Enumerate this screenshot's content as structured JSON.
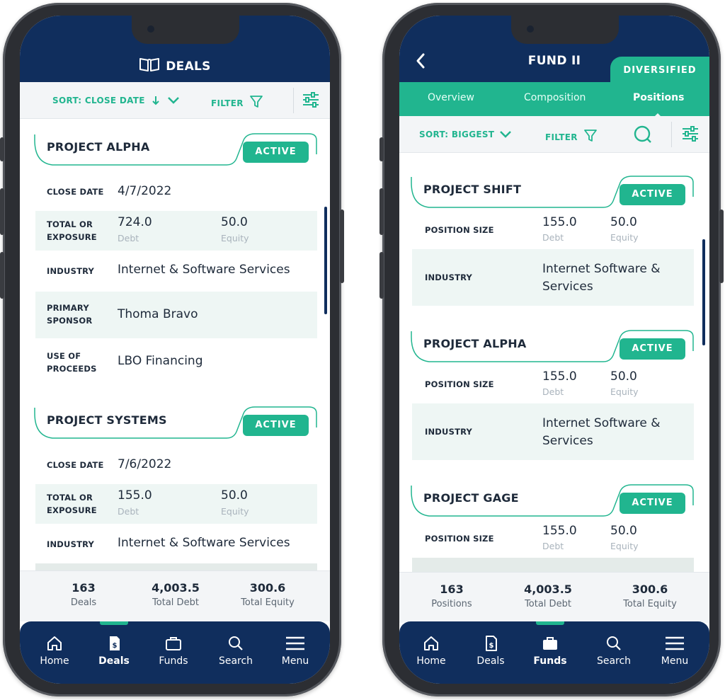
{
  "colors": {
    "navy": "#102e5d",
    "teal": "#21b58f",
    "shade": "#eef6f4"
  },
  "deals_screen": {
    "header": {
      "title": "DEALS",
      "icon": "book-icon"
    },
    "toolbar": {
      "sort_label": "SORT: CLOSE DATE",
      "filter_label": "FILTER"
    },
    "cards": [
      {
        "title": "PROJECT ALPHA",
        "status": "ACTIVE",
        "close_date_label": "CLOSE DATE",
        "close_date": "4/7/2022",
        "exposure_label": "TOTAL OR EXPOSURE",
        "debt": "724.0",
        "debt_label": "Debt",
        "equity": "50.0",
        "equity_label": "Equity",
        "industry_label": "INDUSTRY",
        "industry": "Internet & Software Services",
        "sponsor_label": "PRIMARY SPONSOR",
        "sponsor": "Thoma Bravo",
        "proceeds_label": "USE OF PROCEEDS",
        "proceeds": "LBO Financing"
      },
      {
        "title": "PROJECT SYSTEMS",
        "status": "ACTIVE",
        "close_date_label": "CLOSE DATE",
        "close_date": "7/6/2022",
        "exposure_label": "TOTAL OR EXPOSURE",
        "debt": "155.0",
        "debt_label": "Debt",
        "equity": "50.0",
        "equity_label": "Equity",
        "industry_label": "INDUSTRY",
        "industry": "Internet & Software Services"
      }
    ],
    "stats": [
      {
        "value": "163",
        "label": "Deals"
      },
      {
        "value": "4,003.5",
        "label": "Total Debt"
      },
      {
        "value": "300.6",
        "label": "Total Equity"
      }
    ],
    "nav": [
      {
        "label": "Home",
        "icon": "home-icon"
      },
      {
        "label": "Deals",
        "icon": "document-icon",
        "active": true
      },
      {
        "label": "Funds",
        "icon": "briefcase-icon"
      },
      {
        "label": "Search",
        "icon": "search-icon"
      },
      {
        "label": "Menu",
        "icon": "menu-icon"
      }
    ]
  },
  "fund_screen": {
    "header": {
      "title": "FUND II",
      "tag": "DIVERSIFIED"
    },
    "tabs": [
      {
        "label": "Overview"
      },
      {
        "label": "Composition"
      },
      {
        "label": "Positions",
        "active": true
      }
    ],
    "toolbar": {
      "sort_label": "SORT: BIGGEST",
      "filter_label": "FILTER"
    },
    "cards": [
      {
        "title": "PROJECT SHIFT",
        "status": "ACTIVE",
        "size_label": "POSITION SIZE",
        "debt": "155.0",
        "debt_label": "Debt",
        "equity": "50.0",
        "equity_label": "Equity",
        "industry_label": "INDUSTRY",
        "industry": "Internet Software & Services"
      },
      {
        "title": "PROJECT ALPHA",
        "status": "ACTIVE",
        "size_label": "POSITION SIZE",
        "debt": "155.0",
        "debt_label": "Debt",
        "equity": "50.0",
        "equity_label": "Equity",
        "industry_label": "INDUSTRY",
        "industry": "Internet Software & Services"
      },
      {
        "title": "PROJECT GAGE",
        "status": "ACTIVE",
        "size_label": "POSITION SIZE",
        "debt": "155.0",
        "debt_label": "Debt",
        "equity": "50.0",
        "equity_label": "Equity"
      }
    ],
    "stats": [
      {
        "value": "163",
        "label": "Positions"
      },
      {
        "value": "4,003.5",
        "label": "Total Debt"
      },
      {
        "value": "300.6",
        "label": "Total Equity"
      }
    ],
    "nav": [
      {
        "label": "Home",
        "icon": "home-icon"
      },
      {
        "label": "Deals",
        "icon": "document-icon"
      },
      {
        "label": "Funds",
        "icon": "briefcase-icon",
        "active": true
      },
      {
        "label": "Search",
        "icon": "search-icon"
      },
      {
        "label": "Menu",
        "icon": "menu-icon"
      }
    ]
  }
}
